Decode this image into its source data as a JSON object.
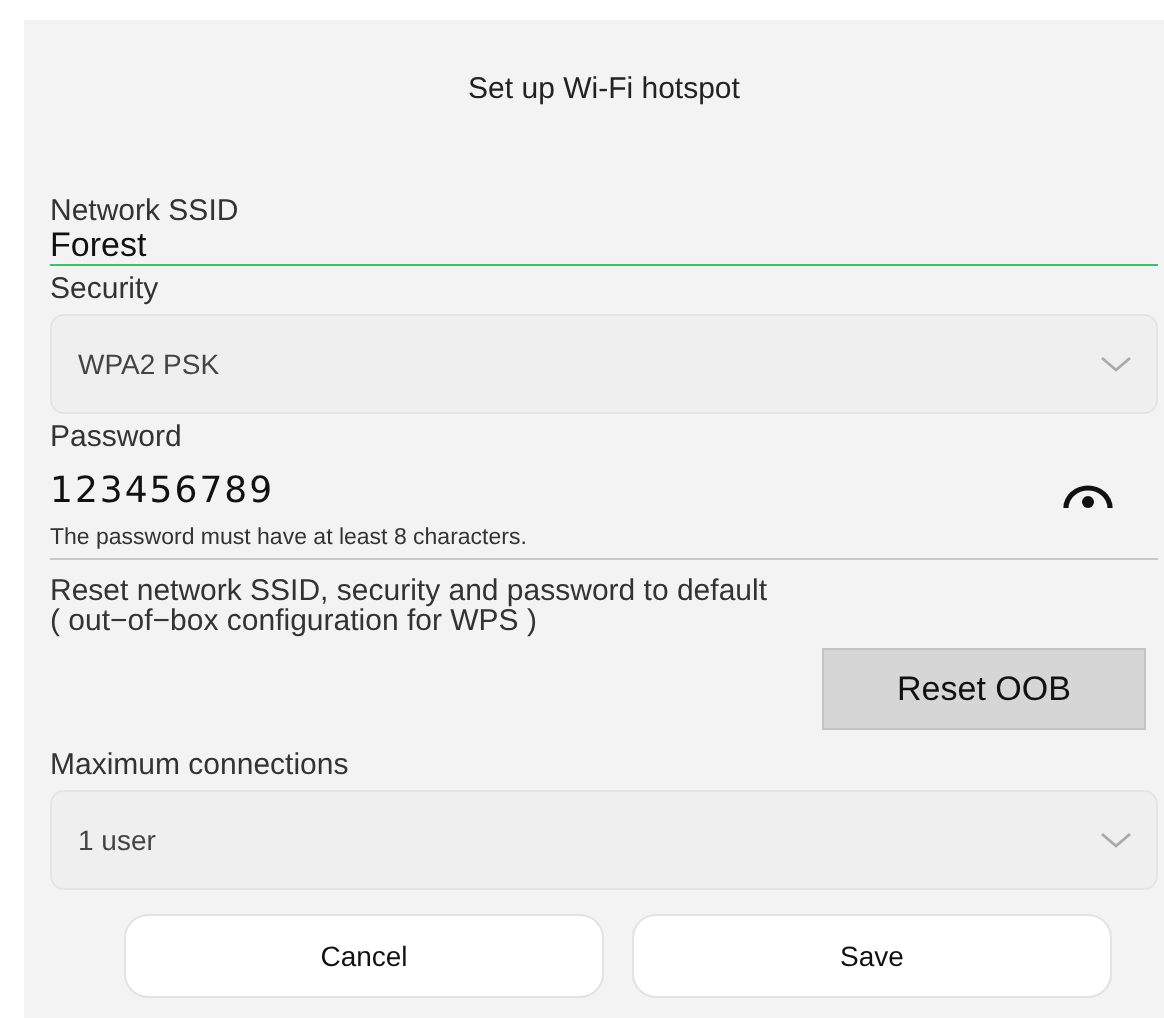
{
  "title": "Set up Wi-Fi hotspot",
  "ssid": {
    "label": "Network SSID",
    "value": "Forest",
    "focused": true
  },
  "security": {
    "label": "Security",
    "value": "WPA2 PSK"
  },
  "password": {
    "label": "Password",
    "value": "123456789",
    "visible": true,
    "hint": "The password must have at least 8 characters."
  },
  "reset": {
    "text": "Reset network SSID, security and password to default",
    "note": "( out−of−box configuration for WPS )",
    "button": "Reset OOB"
  },
  "max_connections": {
    "label": "Maximum connections",
    "value": "1 user"
  },
  "buttons": [
    {
      "label": "Cancel"
    },
    {
      "label": "Save"
    }
  ]
}
